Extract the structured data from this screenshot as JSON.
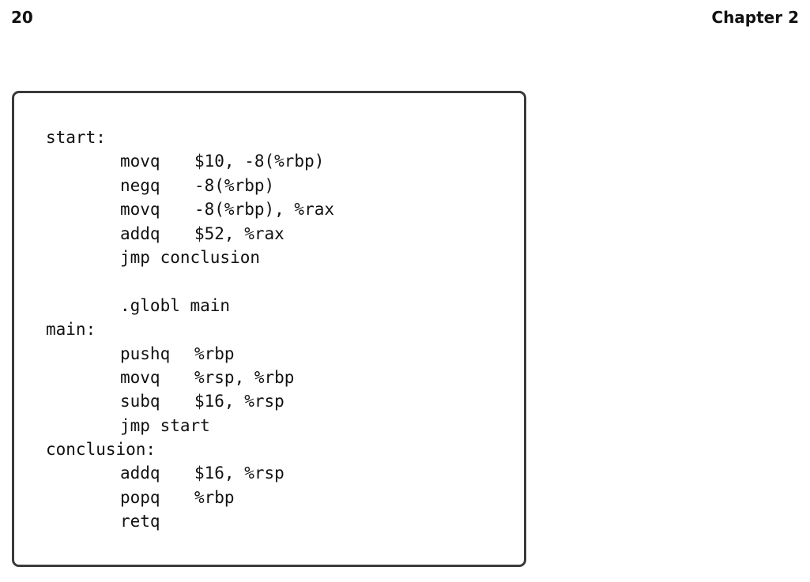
{
  "header": {
    "page_number": "20",
    "chapter": "Chapter 2"
  },
  "listing": [
    {
      "label": "start:",
      "mnemonic": "",
      "operands": ""
    },
    {
      "label": "",
      "mnemonic": "movq",
      "operands": "$10, -8(%rbp)"
    },
    {
      "label": "",
      "mnemonic": "negq",
      "operands": "-8(%rbp)"
    },
    {
      "label": "",
      "mnemonic": "movq",
      "operands": "-8(%rbp), %rax"
    },
    {
      "label": "",
      "mnemonic": "addq",
      "operands": "$52, %rax"
    },
    {
      "label": "",
      "mnemonic": "jmp conclusion",
      "operands": ""
    },
    {
      "label": "",
      "mnemonic": "",
      "operands": ""
    },
    {
      "label": "",
      "mnemonic": ".globl main",
      "operands": ""
    },
    {
      "label": "main:",
      "mnemonic": "",
      "operands": ""
    },
    {
      "label": "",
      "mnemonic": "pushq",
      "operands": "%rbp"
    },
    {
      "label": "",
      "mnemonic": "movq",
      "operands": "%rsp, %rbp"
    },
    {
      "label": "",
      "mnemonic": "subq",
      "operands": "$16, %rsp"
    },
    {
      "label": "",
      "mnemonic": "jmp start",
      "operands": ""
    },
    {
      "label": "conclusion:",
      "mnemonic": "",
      "operands": ""
    },
    {
      "label": "",
      "mnemonic": "addq",
      "operands": "$16, %rsp"
    },
    {
      "label": "",
      "mnemonic": "popq",
      "operands": "%rbp"
    },
    {
      "label": "",
      "mnemonic": "retq",
      "operands": ""
    }
  ]
}
